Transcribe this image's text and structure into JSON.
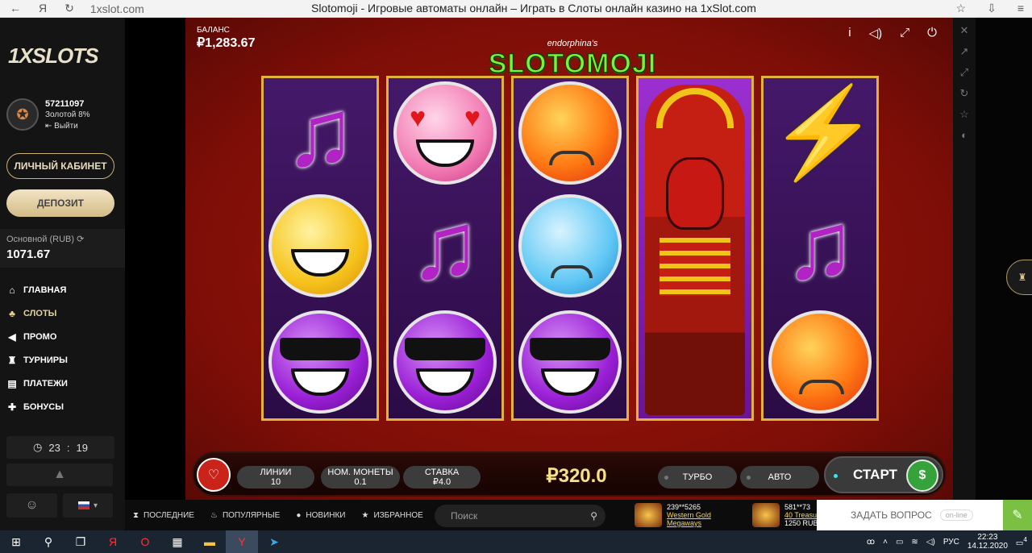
{
  "browser": {
    "back": "←",
    "yandex": "Я",
    "reload": "↻",
    "url": "1xslot.com",
    "title": "Slotomoji - Игровые автоматы онлайн – Играть в Слоты онлайн казино на 1xSlot.com"
  },
  "sidebar": {
    "logo": "1XSLOTS",
    "user_id": "57211097",
    "rank": "Золотой 8%",
    "logout": "⇤ Выйти",
    "cabinet": "ЛИЧНЫЙ КАБИНЕТ",
    "deposit": "ДЕПОЗИТ",
    "balance_label": "Основной (RUB)",
    "balance_value": "1071.67",
    "menu": [
      {
        "icon": "⌂",
        "label": "ГЛАВНАЯ"
      },
      {
        "icon": "♣",
        "label": "СЛОТЫ"
      },
      {
        "icon": "◀",
        "label": "ПРОМО"
      },
      {
        "icon": "♜",
        "label": "ТУРНИРЫ"
      },
      {
        "icon": "▤",
        "label": "ПЛАТЕЖИ"
      },
      {
        "icon": "✚",
        "label": "БОНУСЫ"
      }
    ],
    "clock_hh": "23",
    "clock_sep": ":",
    "clock_mm": "19"
  },
  "game": {
    "balance_label": "БАЛАНС",
    "balance_value": "₽1,283.67",
    "brand_small": "endorphina's",
    "brand_big": "SLOTOMOJI",
    "lines_label": "ЛИНИИ",
    "lines_value": "10",
    "coin_label": "НОМ. МОНЕТЫ",
    "coin_value": "0.1",
    "bet_label": "СТАВКА",
    "bet_value": "₽4.0",
    "total_bet": "₽320.0",
    "turbo": "ТУРБО",
    "auto": "АВТО",
    "start": "СТАРТ"
  },
  "bottom_nav": {
    "recent": "ПОСЛЕДНИЕ",
    "popular": "ПОПУЛЯРНЫЕ",
    "new": "НОВИНКИ",
    "favorites": "ИЗБРАННОЕ",
    "search_placeholder": "Поиск",
    "winner1_id": "239**5265",
    "winner1_game": "Western Gold",
    "winner1_game2": "Megaways",
    "winner2_id": "581**73",
    "winner2_game": "40 Treasu",
    "winner2_amount": "1250 RUB",
    "ask": "ЗАДАТЬ ВОПРОС",
    "status": "on-line"
  },
  "taskbar": {
    "lang": "РУС",
    "time": "22:23",
    "date": "14.12.2020",
    "notif": "4"
  }
}
